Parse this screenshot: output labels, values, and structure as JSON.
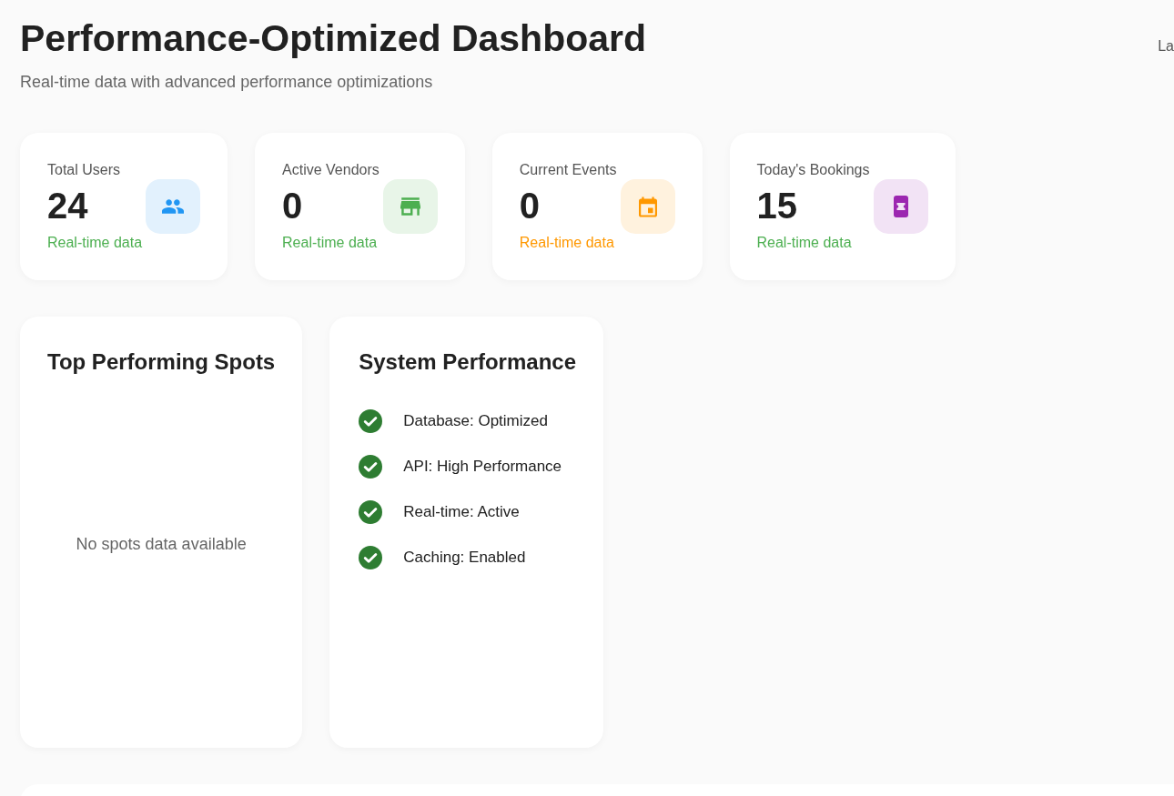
{
  "header": {
    "title": "Performance-Optimized Dashboard",
    "subtitle": "Real-time data with advanced performance optimizations",
    "aside": "La"
  },
  "stats": [
    {
      "label": "Total Users",
      "value": "24",
      "color": "#2196f3",
      "note": {
        "text": "Real-time data",
        "color": "#4caf50"
      }
    },
    {
      "label": "Active Vendors",
      "value": "0",
      "color": "#4caf50",
      "note": {
        "text": "Real-time data",
        "color": "#4caf50"
      }
    },
    {
      "label": "Current Events",
      "value": "0",
      "color": "#ff9800",
      "note": {
        "text": "Real-time data",
        "color": "#ff9800"
      }
    },
    {
      "label": "Today's Bookings",
      "value": "15",
      "color": "#9c27b0",
      "note": {
        "text": "Real-time data",
        "color": "#4caf50"
      }
    }
  ],
  "top_spots": {
    "title": "Top Performing Spots",
    "empty_message": "No spots data available"
  },
  "system_performance": {
    "title": "System Performance",
    "items": [
      {
        "text": "Database: Optimized",
        "checked": true
      },
      {
        "text": "API: High Performance",
        "checked": true
      },
      {
        "text": "Real-time: Active",
        "checked": true
      },
      {
        "text": "Caching: Enabled",
        "checked": true
      }
    ]
  }
}
